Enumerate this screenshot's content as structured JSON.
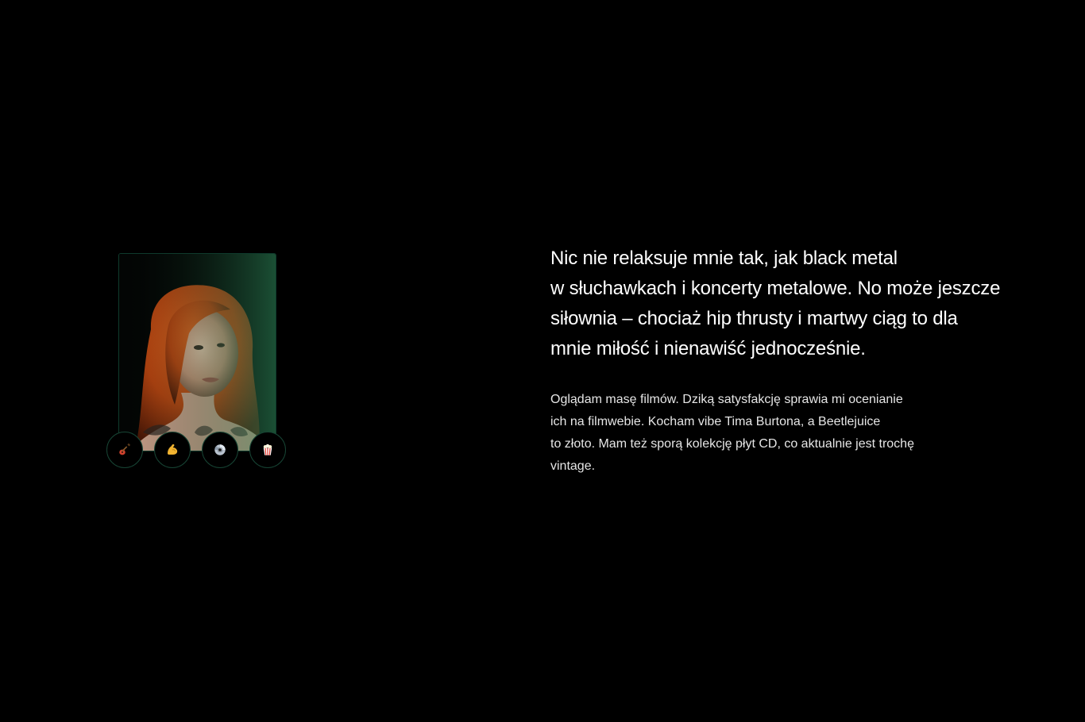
{
  "profile": {
    "photo_alt": "Portret kobiety z rudymi włosami",
    "badges": [
      {
        "icon": "guitar-icon",
        "label": "gitara"
      },
      {
        "icon": "flexed-biceps-icon",
        "label": "siłownia"
      },
      {
        "icon": "cd-icon",
        "label": "płyty CD"
      },
      {
        "icon": "popcorn-icon",
        "label": "filmy"
      }
    ]
  },
  "content": {
    "lead_lines": [
      "Nic nie relaksuje mnie tak, jak black metal",
      "w słuchawkach i koncerty metalowe. No może jeszcze",
      "siłownia – chociaż hip thrusty i martwy ciąg to dla",
      "mnie miłość i nienawiść jednocześnie."
    ],
    "body_lines": [
      "Oglądam masę filmów. Dziką satysfakcję sprawia mi ocenianie",
      "ich na filmwebie. Kocham vibe Tima Burtona, a Beetlejuice",
      "to złoto. Mam też sporą kolekcję płyt CD, co aktualnie jest trochę",
      "vintage."
    ]
  },
  "colors": {
    "background": "#000000",
    "accent_border": "#174434",
    "text": "#ffffff"
  }
}
